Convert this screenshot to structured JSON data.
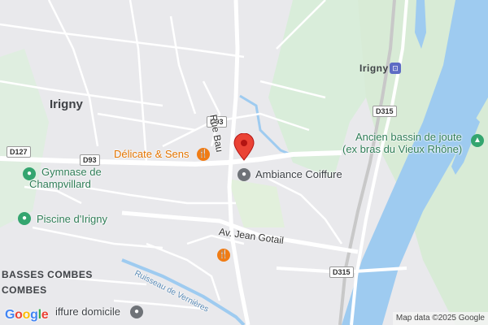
{
  "map": {
    "places": {
      "irigny_town": "Irigny",
      "irigny_station": "Irigny",
      "basses_combes": "BASSES COMBES",
      "combes": "COMBES"
    },
    "roads": {
      "rue_bau": "Rue Bau",
      "av_jean_gotail": "Av. Jean Gotail",
      "ruisseau": "Ruisseau de Vernières"
    },
    "shields": {
      "d93_top": "D93",
      "d93_left": "D93",
      "d127": "D127",
      "d315_top": "D315",
      "d315_bottom": "D315"
    },
    "pois": {
      "delicate": "Délicate & Sens",
      "ambiance": "Ambiance Coiffure",
      "gymnase_line1": "Gymnase de",
      "gymnase_line2": "Champvillard",
      "piscine": "Piscine d'Irigny",
      "bassin_line1": "Ancien bassin de joute",
      "bassin_line2": "(ex bras du Vieux Rhône)",
      "coiffure_domicile": "iffure domicile"
    },
    "icons": {
      "restaurant": "fork-knife-icon",
      "place_pin": "location-pin-icon",
      "train": "train-icon",
      "tree": "tree-icon"
    },
    "colors": {
      "water": "#9ecbf0",
      "park": "#d8ecd8",
      "marker": "#ea4335",
      "restaurant": "#f07c15"
    },
    "logo": "Google",
    "attribution": "Map data ©2025 Google"
  }
}
